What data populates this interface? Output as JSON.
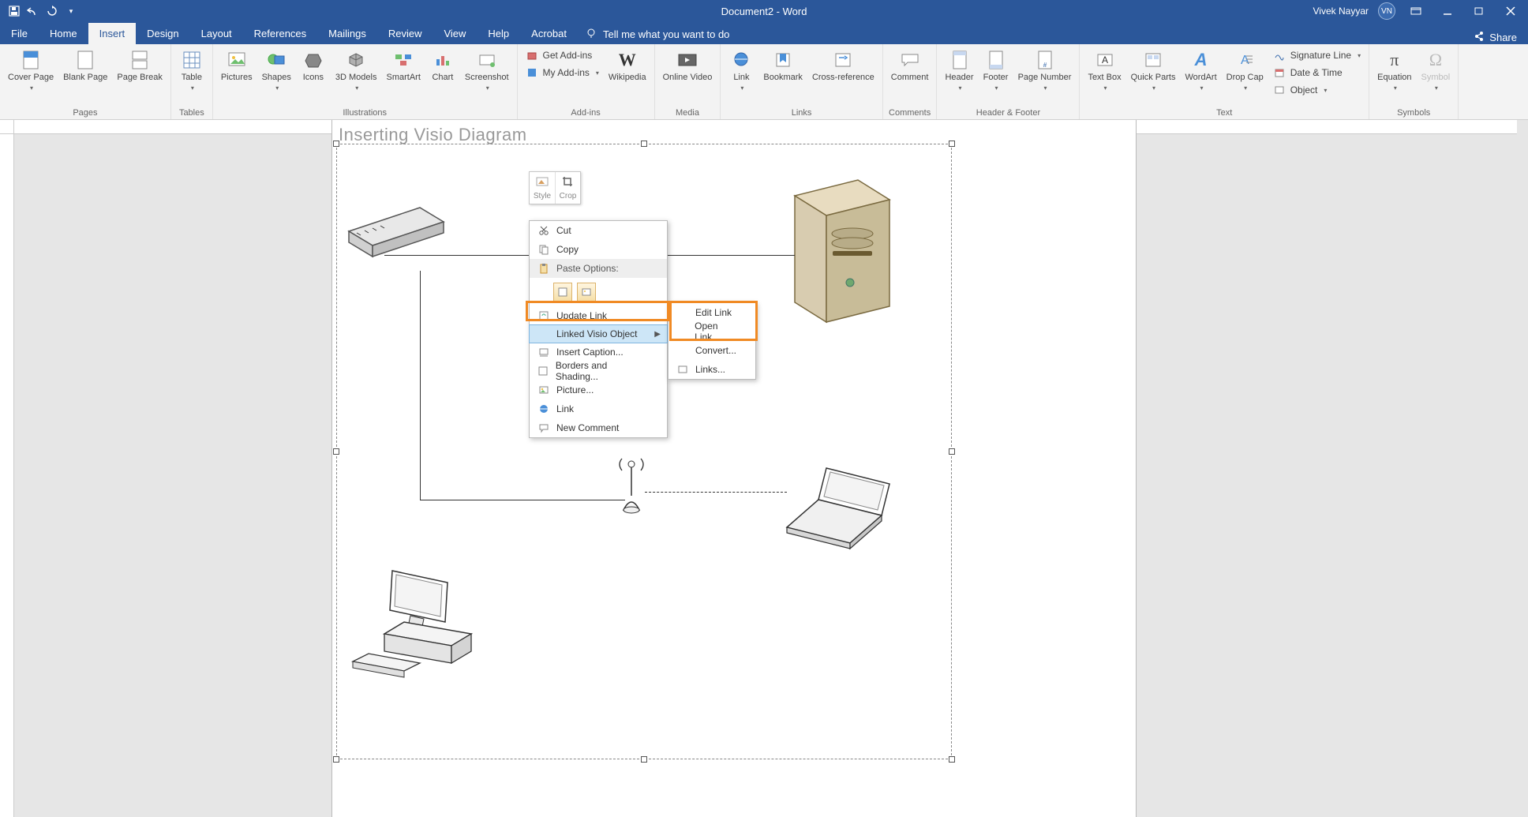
{
  "titlebar": {
    "doc_title": "Document2 - Word",
    "user_name": "Vivek Nayyar",
    "user_initials": "VN",
    "share": "Share"
  },
  "tabs": {
    "file": "File",
    "home": "Home",
    "insert": "Insert",
    "design": "Design",
    "layout": "Layout",
    "references": "References",
    "mailings": "Mailings",
    "review": "Review",
    "view": "View",
    "help": "Help",
    "acrobat": "Acrobat",
    "tell_me": "Tell me what you want to do"
  },
  "ribbon": {
    "pages": {
      "cover": "Cover Page",
      "blank": "Blank Page",
      "break": "Page Break",
      "group": "Pages"
    },
    "tables": {
      "table": "Table",
      "group": "Tables"
    },
    "illustrations": {
      "pictures": "Pictures",
      "shapes": "Shapes",
      "icons": "Icons",
      "models": "3D Models",
      "smartart": "SmartArt",
      "chart": "Chart",
      "screenshot": "Screenshot",
      "group": "Illustrations"
    },
    "addins": {
      "get": "Get Add-ins",
      "my": "My Add-ins",
      "wikipedia": "Wikipedia",
      "group": "Add-ins"
    },
    "media": {
      "video": "Online Video",
      "group": "Media"
    },
    "links": {
      "link": "Link",
      "bookmark": "Bookmark",
      "xref": "Cross-reference",
      "group": "Links"
    },
    "comments": {
      "comment": "Comment",
      "group": "Comments"
    },
    "headerfooter": {
      "header": "Header",
      "footer": "Footer",
      "pagenum": "Page Number",
      "group": "Header & Footer"
    },
    "text": {
      "textbox": "Text Box",
      "quick": "Quick Parts",
      "wordart": "WordArt",
      "dropcap": "Drop Cap",
      "sigline": "Signature Line",
      "datetime": "Date & Time",
      "object": "Object",
      "group": "Text"
    },
    "symbols": {
      "equation": "Equation",
      "symbol": "Symbol",
      "group": "Symbols"
    }
  },
  "document": {
    "heading": "Inserting Visio Diagram"
  },
  "mini_toolbar": {
    "style": "Style",
    "crop": "Crop"
  },
  "context_menu": {
    "cut": "Cut",
    "copy": "Copy",
    "paste_options": "Paste Options:",
    "update_link": "Update Link",
    "linked_visio": "Linked Visio Object",
    "insert_caption": "Insert Caption...",
    "borders": "Borders and Shading...",
    "picture": "Picture...",
    "link": "Link",
    "new_comment": "New Comment"
  },
  "submenu": {
    "edit_link": "Edit  Link",
    "open_link": "Open  Link",
    "convert": "Convert...",
    "links": "Links..."
  }
}
